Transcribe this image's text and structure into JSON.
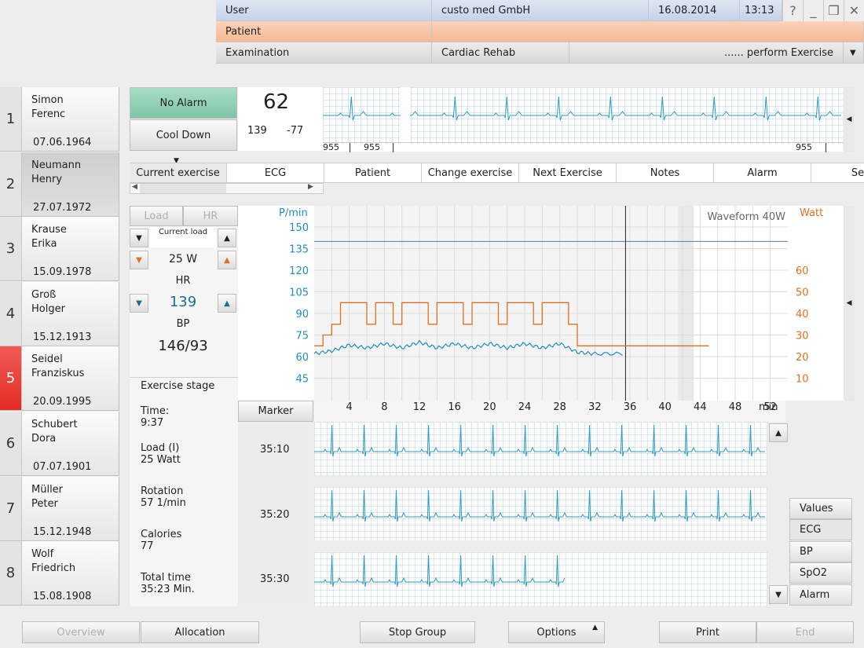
{
  "header": {
    "user_label": "User",
    "user_value": "custo med GmbH",
    "date": "16.08.2014",
    "time": "13:13",
    "patient_label": "Patient",
    "patient_value": "",
    "exam_label": "Examination",
    "exam_value": "Cardiac Rehab",
    "exam_action": "...... perform Exercise"
  },
  "window": {
    "help": "?",
    "minimize": "_",
    "restore": "❐",
    "close": "✕"
  },
  "patients": [
    {
      "num": "1",
      "first": "Simon",
      "last": "Ferenc",
      "date": "07.06.1964"
    },
    {
      "num": "2",
      "first": "Neumann",
      "last": "Henry",
      "date": "27.07.1972"
    },
    {
      "num": "3",
      "first": "Krause",
      "last": "Erika",
      "date": "15.09.1978"
    },
    {
      "num": "4",
      "first": "Groß",
      "last": "Holger",
      "date": "15.12.1913"
    },
    {
      "num": "5",
      "first": "Seidel",
      "last": "Franziskus",
      "date": "20.09.1995"
    },
    {
      "num": "6",
      "first": "Schubert",
      "last": "Dora",
      "date": "07.07.1901"
    },
    {
      "num": "7",
      "first": "Müller",
      "last": "Peter",
      "date": "15.12.1948"
    },
    {
      "num": "8",
      "first": "Wolf",
      "last": "Friedrich",
      "date": "15.08.1908"
    }
  ],
  "monitor": {
    "alarm_label": "No Alarm",
    "cooldown_label": "Cool Down",
    "hr_big": "62",
    "val_a": "139",
    "val_b": "-77",
    "strip_labels": [
      "955",
      "955",
      "955"
    ]
  },
  "tabs": [
    "Current exercise",
    "ECG",
    "Patient",
    "Change exercise",
    "Next Exercise",
    "Notes",
    "Alarm",
    "Set"
  ],
  "controls": {
    "load_tab": "Load",
    "hr_tab": "HR",
    "current_load_label": "Current load",
    "current_load_value": "25 W",
    "hr_label": "HR",
    "hr_value": "139",
    "bp_label": "BP",
    "bp_value": "146/93"
  },
  "stage": {
    "title": "Exercise stage",
    "time_label": "Time:",
    "time_value": "9:37",
    "load_label": "Load (I)",
    "load_value": "25 Watt",
    "rotation_label": "Rotation",
    "rotation_value": "57 1/min",
    "calories_label": "Calories",
    "calories_value": "77",
    "total_label": "Total time",
    "total_value": "35:23 Min."
  },
  "chart_data": {
    "type": "line",
    "left_axis_label": "P/min",
    "right_axis_label": "Watt",
    "annotation": "Waveform 40W",
    "x_unit": "min",
    "x_ticks": [
      4,
      8,
      12,
      16,
      20,
      24,
      28,
      32,
      36,
      40,
      44,
      48,
      52
    ],
    "y_left_ticks": [
      150,
      135,
      120,
      105,
      90,
      75,
      60,
      45
    ],
    "y_right_ticks": [
      60,
      50,
      40,
      30,
      20,
      10
    ],
    "hr_limit": 140,
    "cursor_x": 35.5,
    "watt_series": {
      "name": "Watt",
      "x": [
        0,
        1,
        1,
        2,
        2,
        3,
        3,
        6,
        6,
        7,
        7,
        9,
        9,
        10,
        10,
        13,
        13,
        14,
        14,
        17,
        17,
        18,
        18,
        21,
        21,
        22,
        22,
        25,
        25,
        26,
        26,
        29,
        29,
        30,
        30,
        45
      ],
      "y": [
        25,
        25,
        30,
        30,
        35,
        35,
        45,
        45,
        35,
        35,
        45,
        45,
        35,
        35,
        45,
        45,
        35,
        35,
        45,
        45,
        35,
        35,
        45,
        45,
        35,
        35,
        45,
        45,
        35,
        35,
        45,
        45,
        35,
        35,
        25,
        25
      ]
    },
    "hr_series": {
      "name": "HR",
      "x": [
        0,
        2,
        4,
        6,
        8,
        10,
        12,
        14,
        16,
        18,
        20,
        22,
        24,
        26,
        28,
        30,
        32,
        35.5
      ],
      "y": [
        62,
        64,
        68,
        66,
        69,
        66,
        70,
        66,
        69,
        66,
        69,
        66,
        69,
        66,
        69,
        63,
        62,
        62
      ]
    }
  },
  "marker": {
    "label": "Marker",
    "times": [
      "35:10",
      "35:20",
      "35:30"
    ]
  },
  "side_buttons": [
    "Values",
    "ECG",
    "BP",
    "SpO2",
    "Alarm"
  ],
  "footer": {
    "overview": "Overview",
    "allocation": "Allocation",
    "stop_group": "Stop Group",
    "options": "Options",
    "print": "Print",
    "end": "End"
  },
  "colors": {
    "hr": "#1f8fc0",
    "watt": "#e0701e",
    "alarm_green": "#8ed0b4",
    "patient_alarm": "#e52b25"
  }
}
